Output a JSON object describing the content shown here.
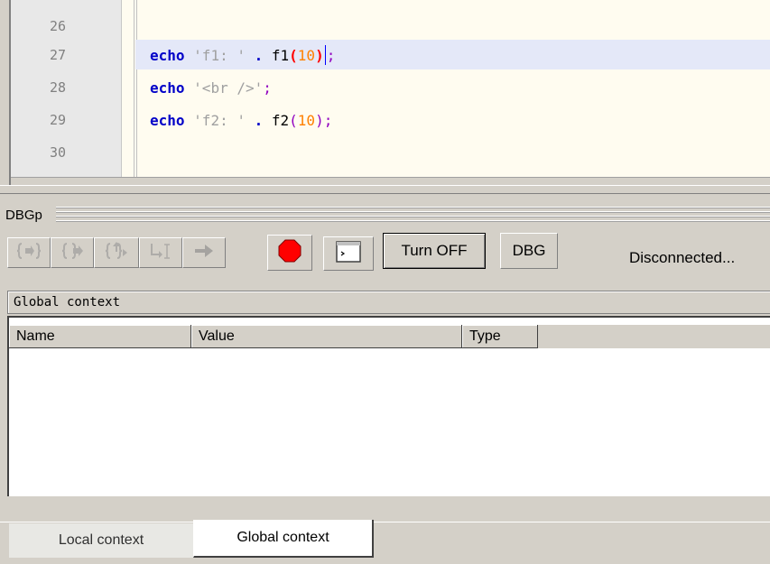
{
  "editor": {
    "line_numbers": [
      "26",
      "27",
      "28",
      "29",
      "30"
    ],
    "lines": [
      {
        "number": "26",
        "segments": []
      },
      {
        "number": "27",
        "segments": [
          {
            "cls": "kw",
            "text": "echo"
          },
          {
            "cls": "plain",
            "text": " "
          },
          {
            "cls": "str",
            "text": "'f1: '"
          },
          {
            "cls": "plain",
            "text": " "
          },
          {
            "cls": "op",
            "text": "."
          },
          {
            "cls": "plain",
            "text": " "
          },
          {
            "cls": "fn",
            "text": "f1"
          },
          {
            "cls": "par-hl",
            "text": "("
          },
          {
            "cls": "num",
            "text": "10"
          },
          {
            "cls": "par-hl",
            "text": ")"
          },
          {
            "cls": "caret",
            "text": ""
          },
          {
            "cls": "semi",
            "text": ";"
          }
        ]
      },
      {
        "number": "28",
        "segments": [
          {
            "cls": "kw",
            "text": "echo"
          },
          {
            "cls": "plain",
            "text": " "
          },
          {
            "cls": "str",
            "text": "'<br />'"
          },
          {
            "cls": "semi",
            "text": ";"
          }
        ]
      },
      {
        "number": "29",
        "segments": [
          {
            "cls": "kw",
            "text": "echo"
          },
          {
            "cls": "plain",
            "text": " "
          },
          {
            "cls": "str",
            "text": "'f2: '"
          },
          {
            "cls": "plain",
            "text": " "
          },
          {
            "cls": "op",
            "text": "."
          },
          {
            "cls": "plain",
            "text": " "
          },
          {
            "cls": "fn",
            "text": "f2"
          },
          {
            "cls": "par",
            "text": "("
          },
          {
            "cls": "num",
            "text": "10"
          },
          {
            "cls": "par",
            "text": ")"
          },
          {
            "cls": "semi",
            "text": ";"
          }
        ]
      },
      {
        "number": "30",
        "segments": []
      }
    ]
  },
  "panel": {
    "title": "DBGp",
    "toolbar": {
      "step_into_icon": "step-into-icon",
      "step_over_icon": "step-over-icon",
      "step_out_icon": "step-out-icon",
      "run_to_cursor_icon": "run-to-cursor-icon",
      "continue_icon": "continue-arrow-icon",
      "breakpoint_icon": "breakpoint-icon",
      "console_icon": "console-icon",
      "turn_off_label": "Turn OFF",
      "dbg_label": "DBG"
    },
    "status": "Disconnected...",
    "context_header": "Global context",
    "columns": [
      "Name",
      "Value",
      "Type"
    ],
    "rows": []
  },
  "tabs": [
    {
      "label": "Local context",
      "active": false
    },
    {
      "label": "Global context",
      "active": true
    }
  ],
  "colors": {
    "keyword": "#0000c8",
    "string": "#a0a0a0",
    "number": "#ff8000",
    "breakpoint": "#ff0000",
    "window": "#d4d0c8"
  }
}
